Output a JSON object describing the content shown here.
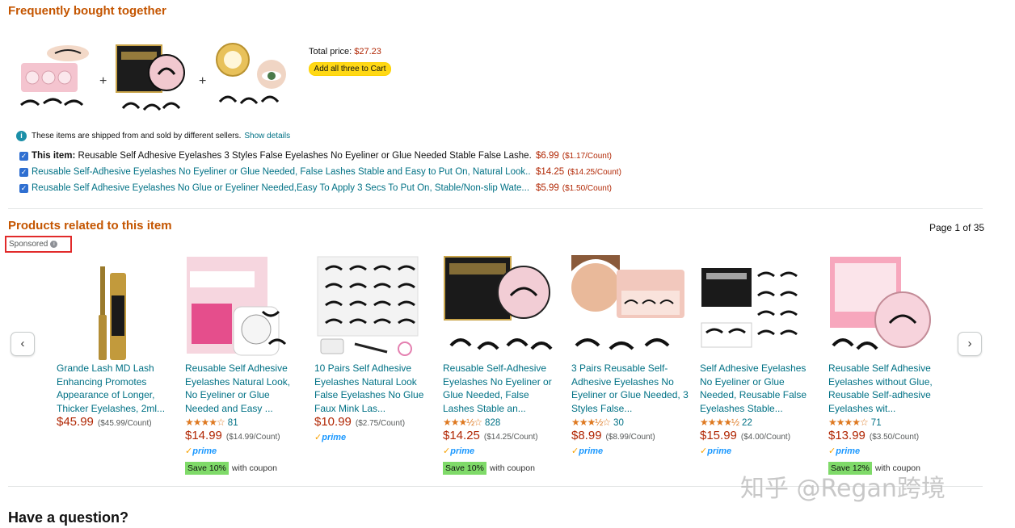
{
  "fbt": {
    "title": "Frequently bought together",
    "total_label": "Total price:",
    "total_value": "$27.23",
    "add_button": "Add all three to Cart",
    "notice": "These items are shipped from and sold by different sellers.",
    "notice_link": "Show details",
    "items": [
      {
        "prefix": "This item:",
        "title": "Reusable Self Adhesive Eyelashes 3 Styles False Eyelashes No Eyeliner or Glue Needed Stable False Lashe...",
        "price": "$6.99",
        "count": "($1.17/Count)"
      },
      {
        "prefix": "",
        "title": "Reusable Self-Adhesive Eyelashes No Eyeliner or Glue Needed, False Lashes Stable and Easy to Put On, Natural Look...",
        "price": "$14.25",
        "count": "($14.25/Count)"
      },
      {
        "prefix": "",
        "title": "Reusable Self Adhesive Eyelashes No Glue or Eyeliner Needed,Easy To Apply 3 Secs To Put On, Stable/Non-slip Wate...",
        "price": "$5.99",
        "count": "($1.50/Count)"
      }
    ]
  },
  "related": {
    "title": "Products related to this item",
    "page_indicator": "Page 1 of 35",
    "sponsored": "Sponsored",
    "products": [
      {
        "title": "Grande Lash MD Lash Enhancing Promotes Appearance of Longer, Thicker Eyelashes, 2ml...",
        "stars": "",
        "rating_count": "",
        "price": "$45.99",
        "per_count": "($45.99/Count)",
        "prime": false,
        "coupon": "",
        "coupon_text": ""
      },
      {
        "title": "Reusable Self Adhesive Eyelashes Natural Look, No Eyeliner or Glue Needed and Easy ...",
        "stars": "★★★★☆",
        "rating_count": "81",
        "price": "$14.99",
        "per_count": "($14.99/Count)",
        "prime": true,
        "coupon": "Save 10%",
        "coupon_text": "with coupon"
      },
      {
        "title": "10 Pairs Self Adhesive Eyelashes Natural Look False Eyelashes No Glue Faux Mink Las...",
        "stars": "",
        "rating_count": "",
        "price": "$10.99",
        "per_count": "($2.75/Count)",
        "prime": true,
        "coupon": "",
        "coupon_text": ""
      },
      {
        "title": "Reusable Self-Adhesive Eyelashes No Eyeliner or Glue Needed, False Lashes Stable an...",
        "stars": "★★★½☆",
        "rating_count": "828",
        "price": "$14.25",
        "per_count": "($14.25/Count)",
        "prime": true,
        "coupon": "Save 10%",
        "coupon_text": "with coupon"
      },
      {
        "title": "3 Pairs Reusable Self-Adhesive Eyelashes No Eyeliner or Glue Needed, 3 Styles False...",
        "stars": "★★★½☆",
        "rating_count": "30",
        "price": "$8.99",
        "per_count": "($8.99/Count)",
        "prime": true,
        "coupon": "",
        "coupon_text": ""
      },
      {
        "title": "Self Adhesive Eyelashes No Eyeliner or Glue Needed, Reusable False Eyelashes Stable...",
        "stars": "★★★★½",
        "rating_count": "22",
        "price": "$15.99",
        "per_count": "($4.00/Count)",
        "prime": true,
        "coupon": "",
        "coupon_text": ""
      },
      {
        "title": "Reusable Self Adhesive Eyelashes without Glue, Reusable Self-adhesive Eyelashes wit...",
        "stars": "★★★★☆",
        "rating_count": "71",
        "price": "$13.99",
        "per_count": "($3.50/Count)",
        "prime": true,
        "coupon": "Save 12%",
        "coupon_text": "with coupon"
      }
    ]
  },
  "question": {
    "title": "Have a question?"
  },
  "watermark": "知乎 @Regan跨境",
  "icons": {
    "info": "info-icon",
    "prev": "chevron-left-icon",
    "next": "chevron-right-icon",
    "check": "checkbox-checked-icon"
  }
}
